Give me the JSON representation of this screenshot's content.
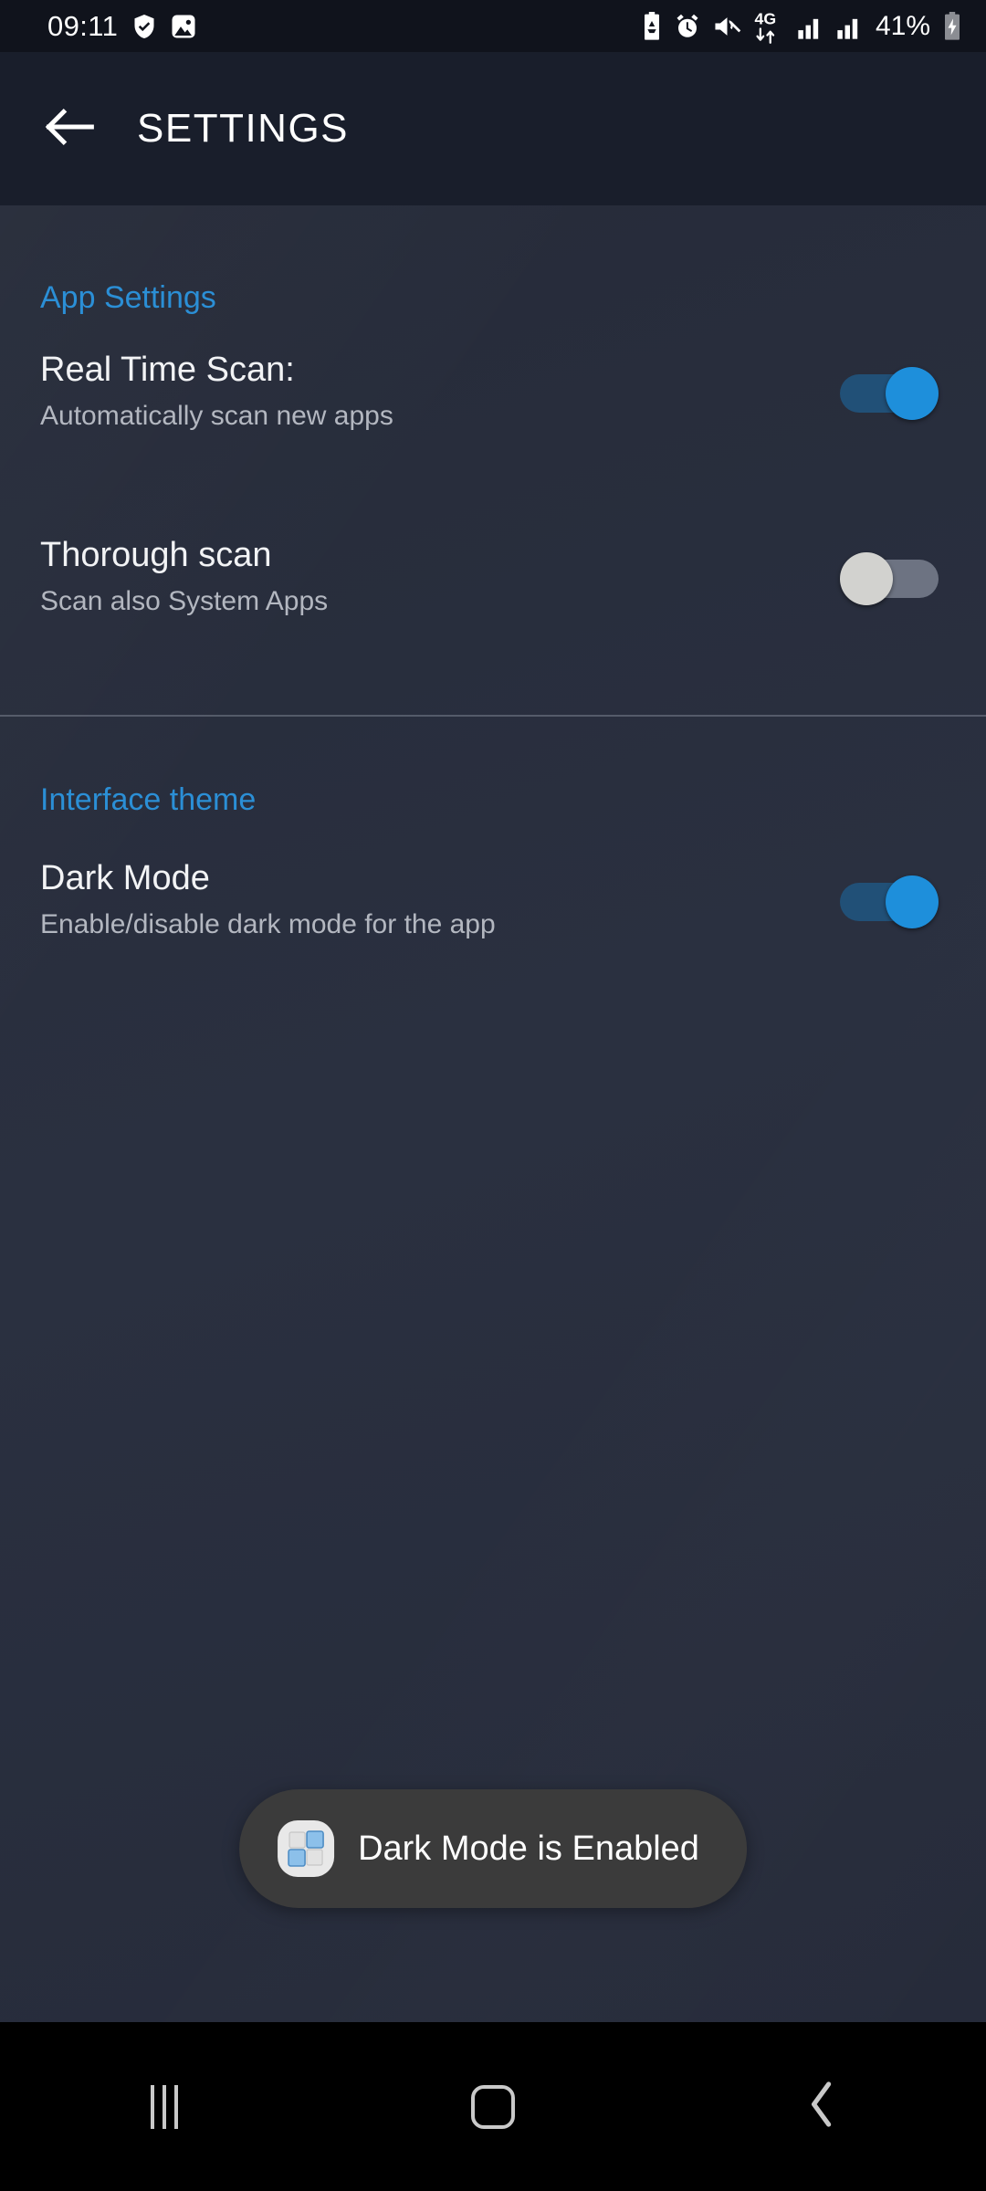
{
  "status_bar": {
    "time": "09:11",
    "battery_percent": "41%",
    "network_type": "4G",
    "left_icons": [
      "shield-check-icon",
      "photo-icon"
    ],
    "right_icons": [
      "battery-saver-icon",
      "alarm-icon",
      "mute-icon",
      "4g-data-icon",
      "signal-bars-sim1-icon",
      "signal-bars-sim2-icon",
      "battery-charging-icon"
    ]
  },
  "toolbar": {
    "back_icon": "arrow-left-icon",
    "title": "SETTINGS"
  },
  "colors": {
    "accent_blue": "#2b8fd6",
    "switch_on_thumb": "#1e8fdb",
    "switch_on_track": "#215077",
    "switch_off_thumb": "#d2d2cf",
    "switch_off_track": "#6d7382",
    "toolbar_bg": "#191e2b",
    "content_bg": "#2a3040",
    "toast_bg": "#3b3b3b"
  },
  "sections": [
    {
      "header": "App Settings",
      "rows": [
        {
          "title": "Real Time Scan:",
          "subtitle": "Automatically scan new apps",
          "switch_state": "on"
        },
        {
          "title": "Thorough scan",
          "subtitle": "Scan also System Apps",
          "switch_state": "off"
        }
      ]
    },
    {
      "header": "Interface theme",
      "rows": [
        {
          "title": "Dark Mode",
          "subtitle": "Enable/disable dark mode for the app",
          "switch_state": "on"
        }
      ]
    }
  ],
  "toast": {
    "message": "Dark Mode is Enabled",
    "icon": "app-grid-icon"
  },
  "nav_bar": {
    "recents_label": "recents-icon",
    "home_label": "home-icon",
    "back_label": "back-icon"
  }
}
